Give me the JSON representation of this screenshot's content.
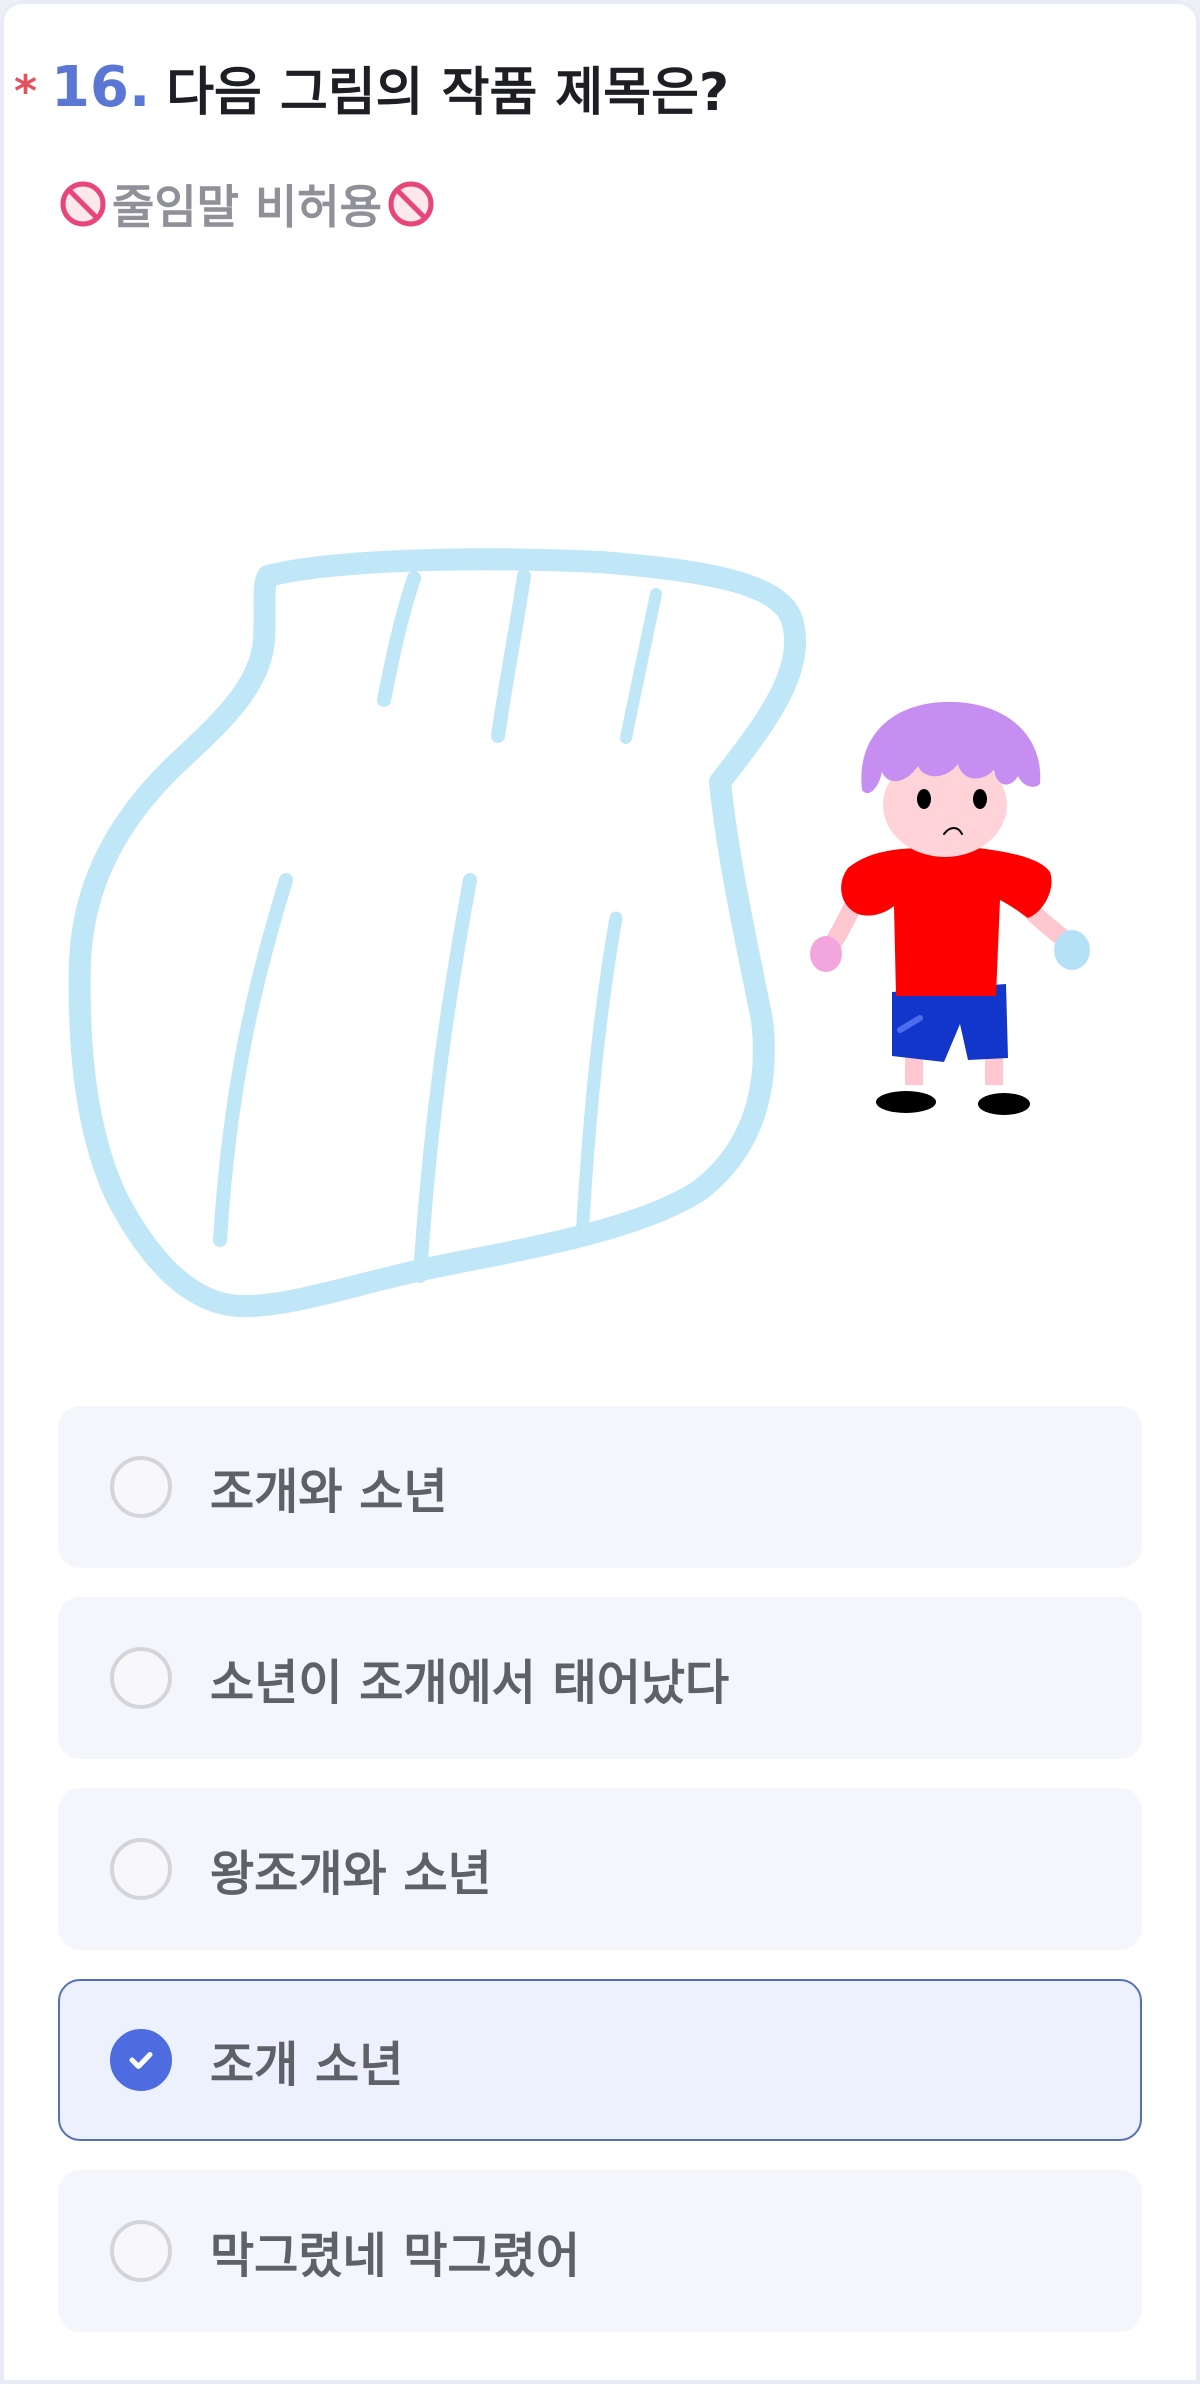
{
  "question": {
    "required_mark": "*",
    "number": "16.",
    "text": "다음 그림의 작품 제목은?",
    "subtitle": "줄임말 비허용",
    "subtitle_icon": "no-entry-icon"
  },
  "illustration": {
    "description_icon": "drawing-shell-and-boy",
    "shell_color": "#bfe7f8",
    "shirt_color": "#ff0000",
    "hair_color": "#c58ef0",
    "shorts_color": "#1136c9"
  },
  "options": [
    {
      "label": "조개와 소년",
      "selected": false
    },
    {
      "label": "소년이 조개에서 태어났다",
      "selected": false
    },
    {
      "label": "왕조개와 소년",
      "selected": false
    },
    {
      "label": "조개 소년",
      "selected": true
    },
    {
      "label": "막그렸네 막그렸어",
      "selected": false
    }
  ],
  "colors": {
    "accent": "#4d6ce0",
    "required": "#e2525f",
    "number": "#5b77d4",
    "selected_border": "#5670b8"
  }
}
